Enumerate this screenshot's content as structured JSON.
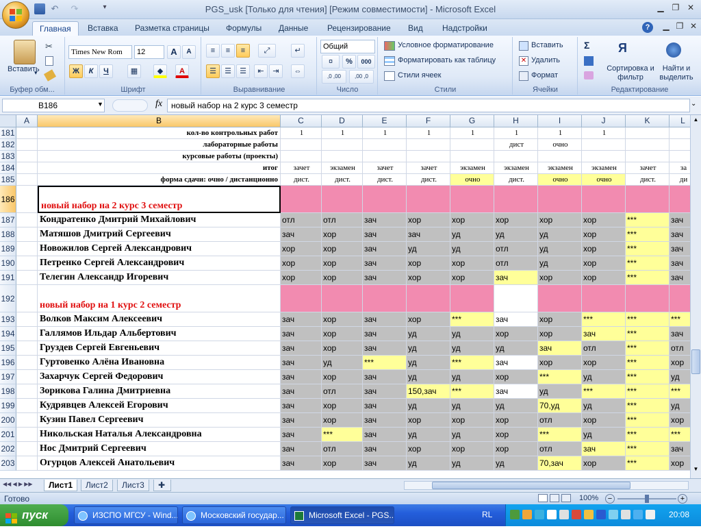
{
  "window": {
    "title": "PGS_usk  [Только для чтения]  [Режим совместимости] - Microsoft Excel"
  },
  "tabs": [
    "Главная",
    "Вставка",
    "Разметка страницы",
    "Формулы",
    "Данные",
    "Рецензирование",
    "Вид",
    "Надстройки"
  ],
  "ribbon": {
    "clipboard": {
      "label": "Буфер обм...",
      "paste": "Вставить"
    },
    "font": {
      "label": "Шрифт",
      "name": "Times New Rom",
      "size": "12",
      "bold": "Ж",
      "italic": "К",
      "underline": "Ч",
      "grow": "A",
      "shrink": "A"
    },
    "alignment": {
      "label": "Выравнивание"
    },
    "number": {
      "label": "Число",
      "format": "Общий",
      "percent": "%",
      "thousands": "000",
      "inc": ",0 ,00",
      "dec": ",00 ,0"
    },
    "styles": {
      "label": "Стили",
      "cond": "Условное форматирование",
      "table": "Форматировать как таблицу",
      "cell": "Стили ячеек"
    },
    "cells": {
      "label": "Ячейки",
      "insert": "Вставить",
      "delete": "Удалить",
      "format": "Формат"
    },
    "editing": {
      "label": "Редактирование",
      "sum": "Σ",
      "sort": "Сортировка и фильтр",
      "find": "Найти и выделить"
    }
  },
  "formula_bar": {
    "name_box": "B186",
    "fx": "fx",
    "formula": "новый набор на 2 курс 3 семестр"
  },
  "columns": [
    "A",
    "B",
    "C",
    "D",
    "E",
    "F",
    "G",
    "H",
    "I",
    "J",
    "K",
    "L"
  ],
  "header_rows": [
    {
      "num": "181",
      "label": "кол-во контрольных работ",
      "cells": [
        "1",
        "1",
        "1",
        "1",
        "1",
        "1",
        "1",
        "1",
        "",
        ""
      ]
    },
    {
      "num": "182",
      "label": "лабораторные работы",
      "cells": [
        "",
        "",
        "",
        "",
        "",
        "дист",
        "очно",
        "",
        "",
        ""
      ]
    },
    {
      "num": "183",
      "label": "курсовые работы (проекты)",
      "cells": [
        "",
        "",
        "",
        "",
        "",
        "",
        "",
        "",
        "",
        ""
      ]
    },
    {
      "num": "184",
      "label": "итог",
      "cells": [
        "зачет",
        "экзамен",
        "зачет",
        "зачет",
        "экзамен",
        "экзамен",
        "экзамен",
        "экзамен",
        "зачет",
        "за"
      ]
    },
    {
      "num": "185",
      "label": "форма сдачи: очно / дистанционно",
      "cells": [
        "дист.",
        "дист.",
        "дист.",
        "дист.",
        "очно",
        "дист.",
        "очно",
        "очно",
        "дист.",
        "ди"
      ]
    }
  ],
  "sections": [
    {
      "num": "186",
      "title": "новый набор на 2 курс 3 семестр"
    },
    {
      "num": "192",
      "title": "новый набор на 1 курс 2 семестр"
    }
  ],
  "students": [
    {
      "num": "187",
      "name": "Кондратенко Дмитрий Михайлович",
      "g": [
        "отл",
        "отл",
        "зач",
        "хор",
        "хор",
        "хор",
        "хор",
        "хор",
        "***",
        "зач"
      ]
    },
    {
      "num": "188",
      "name": "Матяшов Дмитрий Сергеевич",
      "g": [
        "зач",
        "хор",
        "зач",
        "зач",
        "уд",
        "уд",
        "уд",
        "хор",
        "***",
        "зач"
      ]
    },
    {
      "num": "189",
      "name": "Новожилов Сергей Александрович",
      "g": [
        "хор",
        "хор",
        "зач",
        "уд",
        "уд",
        "отл",
        "уд",
        "хор",
        "***",
        "зач"
      ]
    },
    {
      "num": "190",
      "name": "Петренко Сергей Александрович",
      "g": [
        "хор",
        "хор",
        "зач",
        "хор",
        "хор",
        "отл",
        "уд",
        "хор",
        "***",
        "зач"
      ]
    },
    {
      "num": "191",
      "name": "Телегин Александр Игоревич",
      "g": [
        "хор",
        "хор",
        "зач",
        "хор",
        "хор",
        "зач",
        "хор",
        "хор",
        "***",
        "зач"
      ]
    },
    {
      "num": "193",
      "name": "Волков Максим Алексеевич",
      "g": [
        "зач",
        "хор",
        "зач",
        "хор",
        "***",
        "зач",
        "хор",
        "***",
        "***",
        "***"
      ]
    },
    {
      "num": "194",
      "name": "Галлямов Ильдар Альбертович",
      "g": [
        "зач",
        "хор",
        "зач",
        "уд",
        "уд",
        "хор",
        "хор",
        "зач",
        "***",
        "зач"
      ]
    },
    {
      "num": "195",
      "name": "Груздев Сергей Евгеньевич",
      "g": [
        "зач",
        "хор",
        "зач",
        "уд",
        "уд",
        "уд",
        "зач",
        "отл",
        "***",
        "отл"
      ]
    },
    {
      "num": "196",
      "name": "Гуртовенко Алёна Ивановна",
      "g": [
        "зач",
        "уд",
        "***",
        "уд",
        "***",
        "зач",
        "хор",
        "хор",
        "***",
        "хор"
      ]
    },
    {
      "num": "197",
      "name": "Захарчук Сергей Федорович",
      "g": [
        "зач",
        "хор",
        "зач",
        "уд",
        "уд",
        "хор",
        "***",
        "уд",
        "***",
        "уд"
      ]
    },
    {
      "num": "198",
      "name": "Зорикова Галина Дмитриевна",
      "g": [
        "зач",
        "отл",
        "зач",
        "150,зач",
        "***",
        "зач",
        "уд",
        "***",
        "***",
        "***"
      ]
    },
    {
      "num": "199",
      "name": "Кудрявцев Алексей Егорович",
      "g": [
        "зач",
        "хор",
        "зач",
        "уд",
        "уд",
        "уд",
        "70,уд",
        "уд",
        "***",
        "уд"
      ]
    },
    {
      "num": "200",
      "name": "Кузин Павел Сергеевич",
      "g": [
        "зач",
        "хор",
        "зач",
        "хор",
        "хор",
        "хор",
        "отл",
        "хор",
        "***",
        "хор"
      ]
    },
    {
      "num": "201",
      "name": "Никольская Наталья Александровна",
      "g": [
        "зач",
        "***",
        "зач",
        "уд",
        "уд",
        "хор",
        "***",
        "уд",
        "***",
        "***"
      ]
    },
    {
      "num": "202",
      "name": "Нос Дмитрий Сергеевич",
      "g": [
        "зач",
        "отл",
        "зач",
        "хор",
        "хор",
        "хор",
        "отл",
        "зач",
        "***",
        "зач"
      ]
    },
    {
      "num": "203",
      "name": "Огурцов Алексей Анатольевич",
      "g": [
        "зач",
        "хор",
        "зач",
        "уд",
        "уд",
        "уд",
        "70,зач",
        "хор",
        "***",
        "хор"
      ]
    }
  ],
  "sheets": [
    "Лист1",
    "Лист2",
    "Лист3"
  ],
  "status": {
    "ready": "Готово",
    "zoom": "100%"
  },
  "taskbar": {
    "start": "пуск",
    "tasks": [
      "ИЗСПО МГСУ - Wind...",
      "Московский государ...",
      "Microsoft Excel - PGS..."
    ],
    "lang": "RL",
    "clock": "20:08"
  },
  "colors": {
    "pink": "#f28bb0",
    "yellow": "#ffff99",
    "gray": "#c0c0c0",
    "white": "#ffffff"
  }
}
